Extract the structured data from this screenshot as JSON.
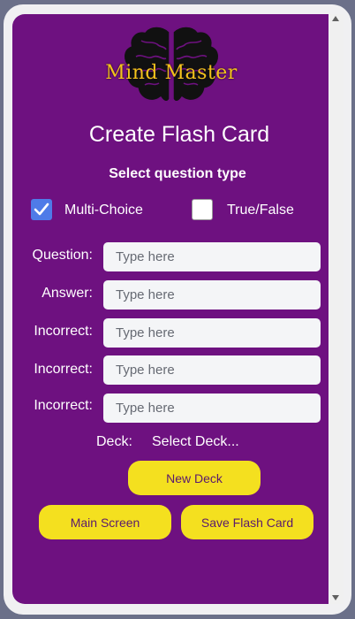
{
  "logo": {
    "text": "Mind Master"
  },
  "page": {
    "title": "Create Flash Card"
  },
  "question_type": {
    "heading": "Select question type",
    "options": [
      {
        "label": "Multi-Choice",
        "checked": true
      },
      {
        "label": "True/False",
        "checked": false
      }
    ]
  },
  "fields": [
    {
      "label": "Question:",
      "placeholder": "Type here"
    },
    {
      "label": "Answer:",
      "placeholder": "Type here"
    },
    {
      "label": "Incorrect:",
      "placeholder": "Type here"
    },
    {
      "label": "Incorrect:",
      "placeholder": "Type here"
    },
    {
      "label": "Incorrect:",
      "placeholder": "Type here"
    }
  ],
  "deck": {
    "label": "Deck:",
    "value": "Select Deck..."
  },
  "buttons": {
    "new_deck": "New Deck",
    "main_screen": "Main Screen",
    "save": "Save Flash Card"
  },
  "colors": {
    "panel": "#6e1180",
    "accent_yellow": "#f4e01f",
    "checkbox_blue": "#4f7be8"
  }
}
